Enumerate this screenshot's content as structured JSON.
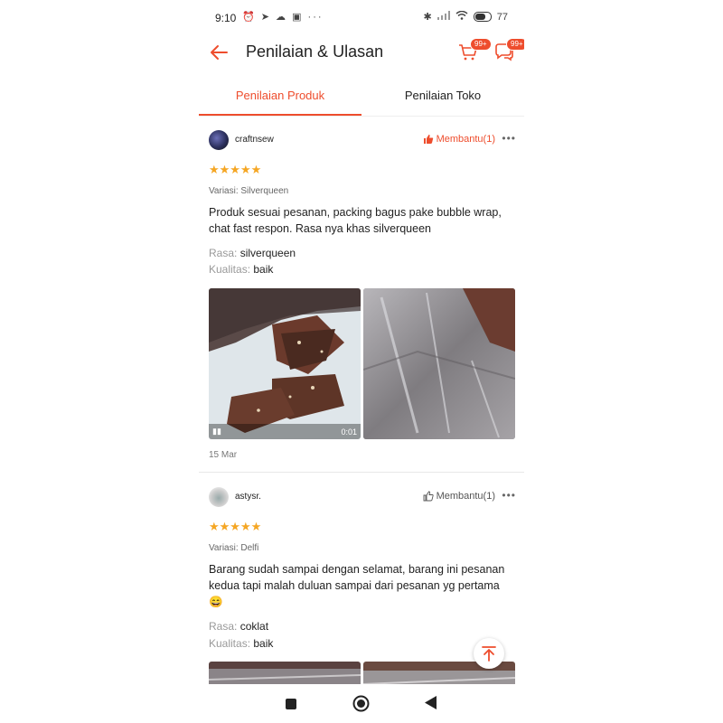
{
  "status_bar": {
    "time": "9:10",
    "battery": "77"
  },
  "header": {
    "title": "Penilaian & Ulasan",
    "cart_badge": "99+",
    "chat_badge": "99+"
  },
  "tabs": [
    {
      "label": "Penilaian Produk",
      "active": true
    },
    {
      "label": "Penilaian Toko",
      "active": false
    }
  ],
  "reviews": [
    {
      "username": "craftnsew",
      "helpful_label": "Membantu(1)",
      "rating": 5,
      "stars": "★★★★★",
      "variation": "Variasi: Silverqueen",
      "text": "Produk sesuai pesanan, packing bagus pake bubble wrap, chat fast respon. Rasa nya khas silverqueen",
      "attributes": [
        {
          "key": "Rasa:",
          "value": "silverqueen"
        },
        {
          "key": "Kualitas:",
          "value": "baik"
        }
      ],
      "video_duration": "0:01",
      "date": "15 Mar"
    },
    {
      "username": "astysr.",
      "helpful_label": "Membantu(1)",
      "rating": 5,
      "stars": "★★★★★",
      "variation": "Variasi: Delfi",
      "text": "Barang sudah sampai dengan selamat, barang ini pesanan kedua tapi malah duluan sampai dari pesanan yg pertama 😄",
      "attributes": [
        {
          "key": "Rasa:",
          "value": "coklat"
        },
        {
          "key": "Kualitas:",
          "value": "baik"
        }
      ]
    }
  ],
  "colors": {
    "accent": "#ee4d2d",
    "star": "#f5a623"
  }
}
